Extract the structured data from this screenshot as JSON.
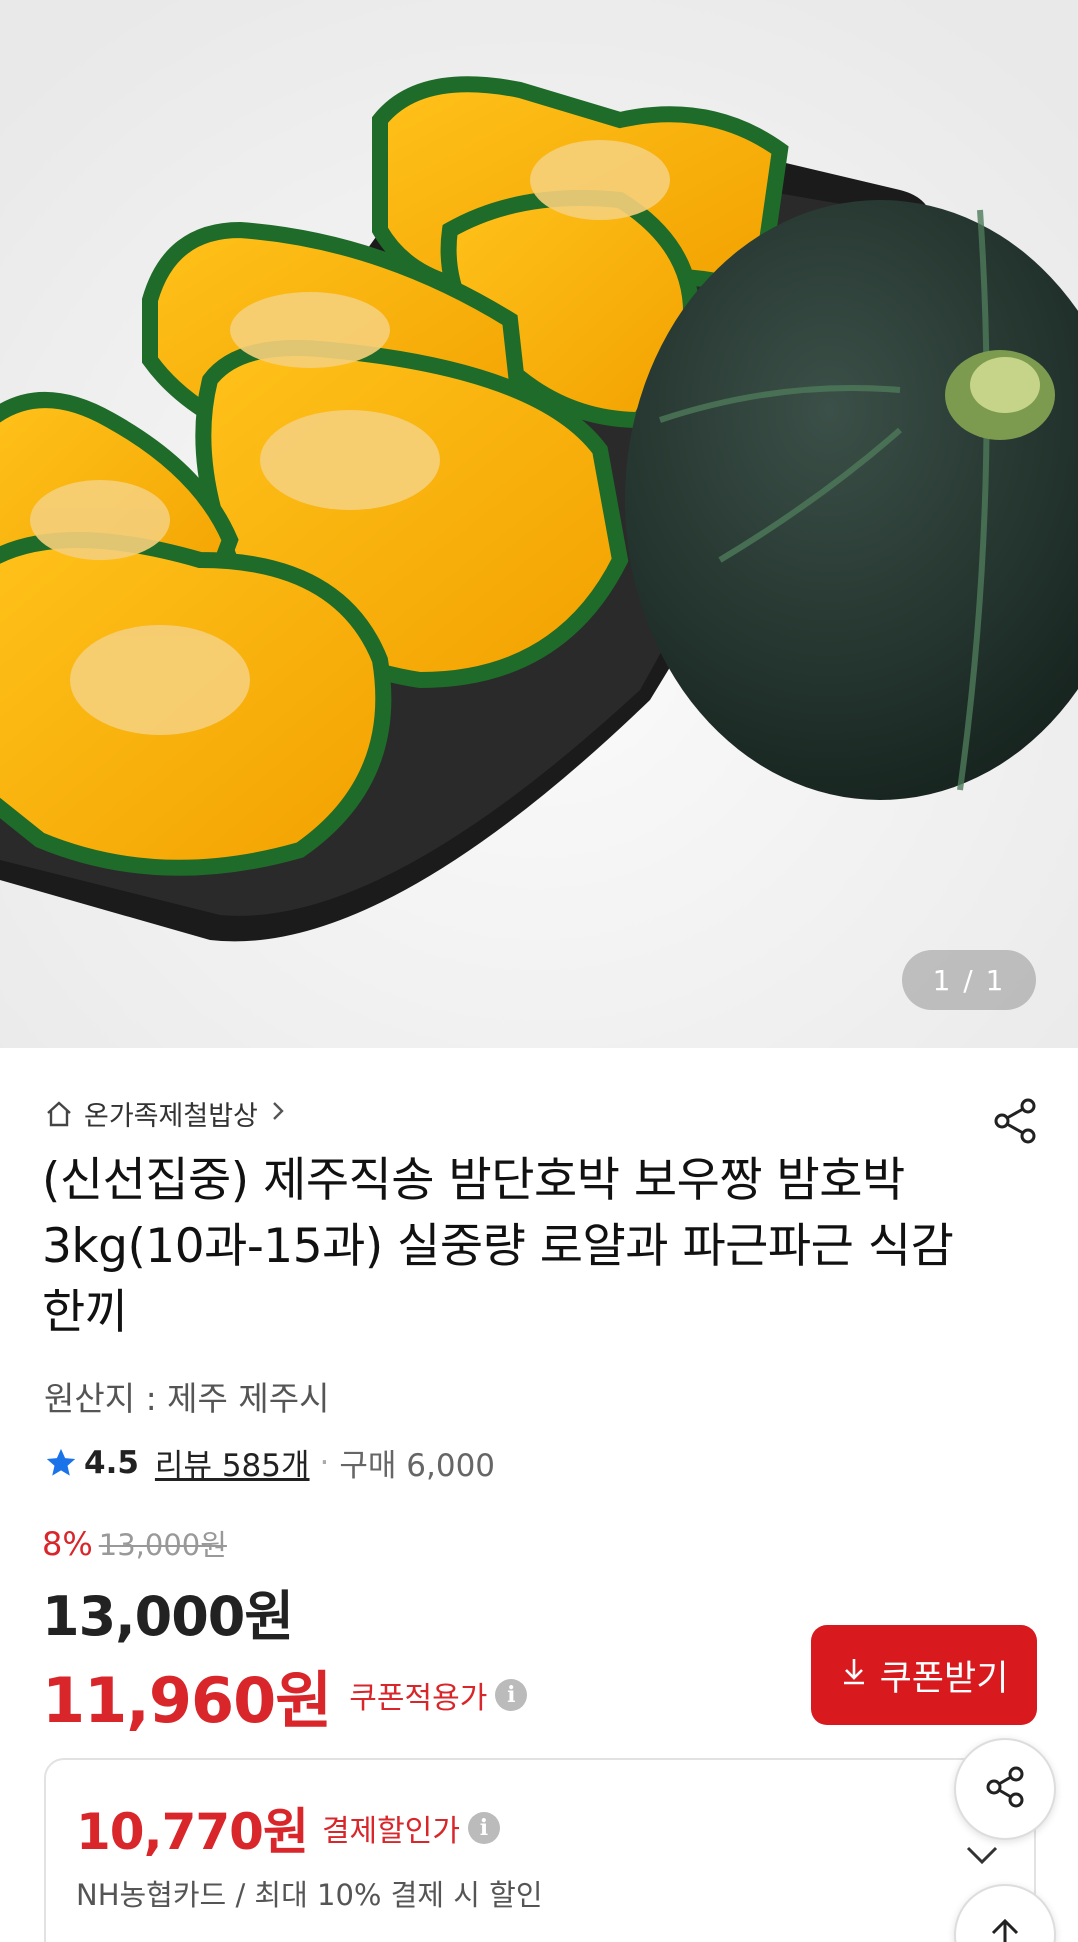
{
  "gallery": {
    "counter": "1 / 1"
  },
  "product": {
    "breadcrumb": "온가족제철밥상",
    "title": "(신선집중) 제주직송 밤단호박 보우짱 밤호박 3kg(10과-15과) 실중량 로얄과 파근파근 식감 한끼",
    "origin": "원산지 : 제주 제주시",
    "rating": "4.5",
    "review_label": "리뷰 585개",
    "purchase": "구매 6,000"
  },
  "pricing": {
    "discount_pct": "8%",
    "original_price": "13,000원",
    "price": "13,000원",
    "coupon_price": "11,960원",
    "coupon_label": "쿠폰적용가",
    "coupon_button": "쿠폰받기"
  },
  "payment": {
    "price": "10,770원",
    "label": "결제할인가",
    "desc": "NH농협카드 / 최대 10% 결제 시 할인"
  },
  "icons": [
    "home-icon",
    "chevron-right-icon",
    "share-icon",
    "star-icon",
    "info-icon",
    "download-icon",
    "chevron-down-icon",
    "arrow-up-icon"
  ],
  "colors": {
    "accent_red": "#d8191d",
    "star_blue": "#1a73e8"
  }
}
